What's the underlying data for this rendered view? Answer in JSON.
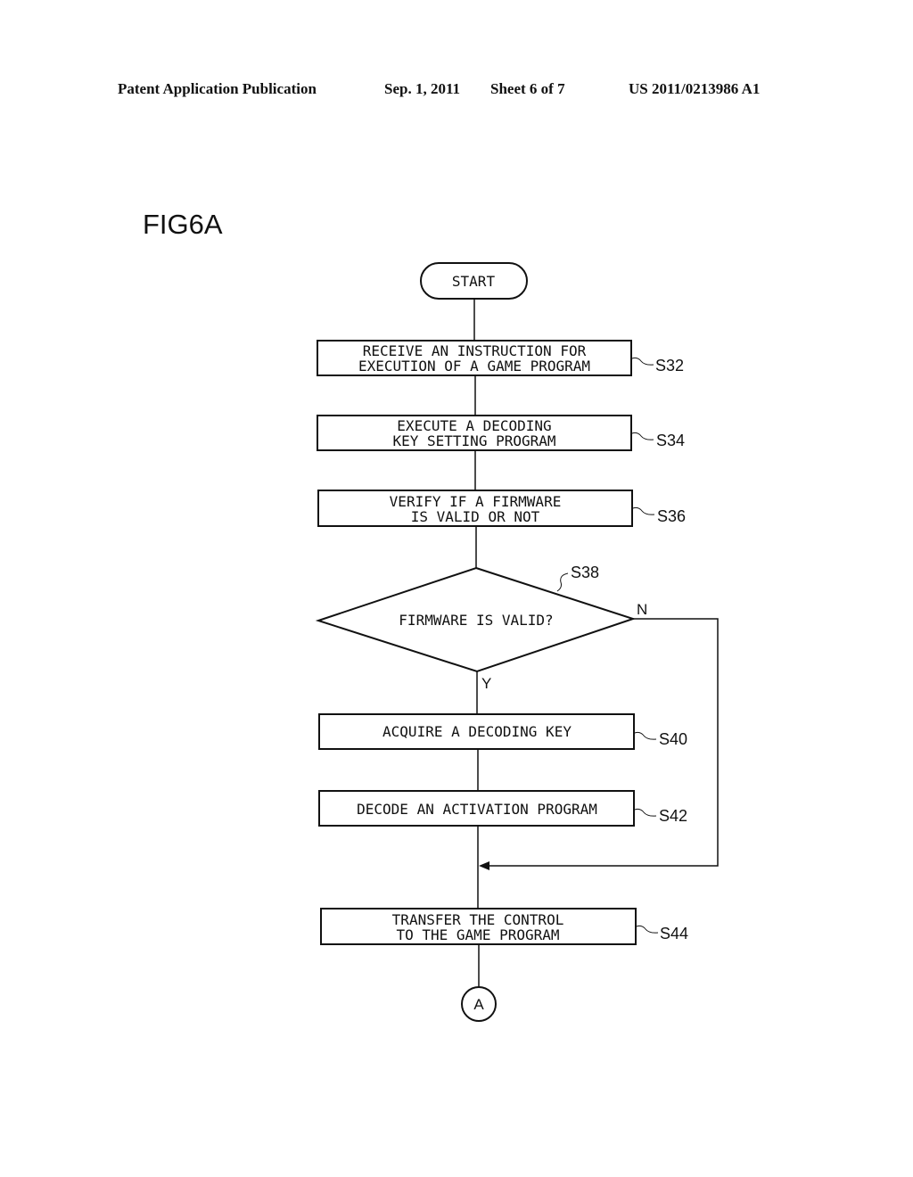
{
  "header": {
    "publication": "Patent Application Publication",
    "date": "Sep. 1, 2011",
    "sheet": "Sheet 6 of 7",
    "number": "US 2011/0213986 A1"
  },
  "figure_label": "FIG6A",
  "flowchart": {
    "start": "START",
    "steps": [
      {
        "id": "S32",
        "lines": [
          "RECEIVE AN INSTRUCTION FOR",
          "EXECUTION OF A GAME PROGRAM"
        ]
      },
      {
        "id": "S34",
        "lines": [
          "EXECUTE A DECODING",
          "KEY SETTING PROGRAM"
        ]
      },
      {
        "id": "S36",
        "lines": [
          "VERIFY IF A FIRMWARE",
          "IS VALID OR NOT"
        ]
      },
      {
        "id": "S40",
        "lines": [
          "ACQUIRE A DECODING KEY"
        ]
      },
      {
        "id": "S42",
        "lines": [
          "DECODE AN ACTIVATION PROGRAM"
        ]
      },
      {
        "id": "S44",
        "lines": [
          "TRANSFER THE CONTROL",
          "TO THE GAME PROGRAM"
        ]
      }
    ],
    "decision": {
      "id": "S38",
      "text": "FIRMWARE IS VALID?",
      "yes_label": "Y",
      "no_label": "N"
    },
    "connector": "A"
  }
}
